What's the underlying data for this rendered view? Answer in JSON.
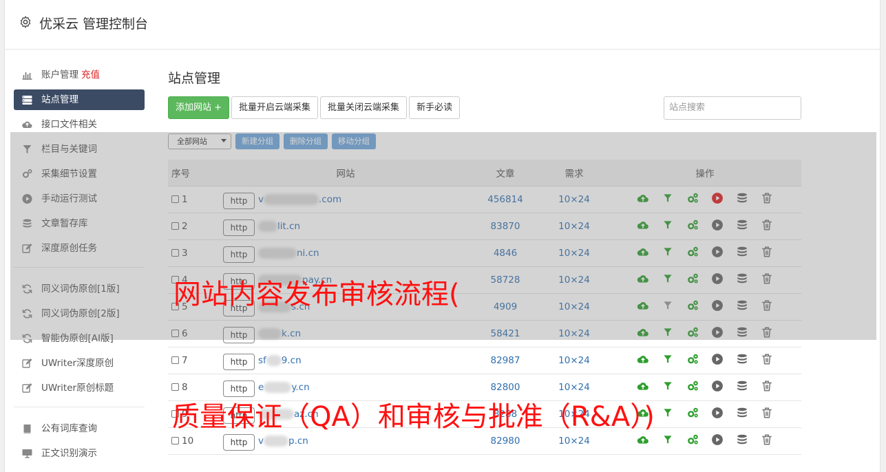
{
  "header": {
    "title": "优采云 管理控制台"
  },
  "sidebar": {
    "items": [
      {
        "label": "账户管理",
        "extra": "充值"
      },
      {
        "label": "站点管理"
      },
      {
        "label": "接口文件相关"
      },
      {
        "label": "栏目与关键词"
      },
      {
        "label": "采集细节设置"
      },
      {
        "label": "手动运行测试"
      },
      {
        "label": "文章暂存库"
      },
      {
        "label": "深度原创任务"
      },
      {
        "label": "同义词伪原创[1版]"
      },
      {
        "label": "同义词伪原创[2版]"
      },
      {
        "label": "智能伪原创[AI版]"
      },
      {
        "label": "UWriter深度原创"
      },
      {
        "label": "UWriter原创标题"
      },
      {
        "label": "公有词库查询"
      },
      {
        "label": "正文识别演示"
      }
    ]
  },
  "main": {
    "title": "站点管理",
    "buttons": {
      "add": "添加网站 +",
      "enable_cloud": "批量开启云端采集",
      "disable_cloud": "批量关闭云端采集",
      "guide": "新手必读"
    },
    "search_placeholder": "站点搜索",
    "group_select": "全部网站",
    "group_buttons": {
      "new": "新建分组",
      "delete": "删除分组",
      "move": "移动分组"
    },
    "columns": {
      "no": "序号",
      "site": "网站",
      "articles": "文章",
      "demand": "需求",
      "ops": "操作"
    },
    "http_label": "http",
    "rows": [
      {
        "no": "1",
        "prefix": "v",
        "suffix": ".com",
        "articles": "456814",
        "demand": "10×24",
        "running": true,
        "filter_on": true
      },
      {
        "no": "2",
        "prefix": "",
        "suffix": "lit.cn",
        "articles": "83870",
        "demand": "10×24",
        "running": false,
        "filter_on": true
      },
      {
        "no": "3",
        "prefix": "",
        "suffix": "ni.cn",
        "articles": "4846",
        "demand": "10×24",
        "running": false,
        "filter_on": true
      },
      {
        "no": "4",
        "prefix": "",
        "suffix": "pay.cn",
        "articles": "58728",
        "demand": "10×24",
        "running": false,
        "filter_on": true
      },
      {
        "no": "5",
        "prefix": "",
        "suffix": "s.cn",
        "articles": "4909",
        "demand": "10×24",
        "running": false,
        "filter_on": false
      },
      {
        "no": "6",
        "prefix": "",
        "suffix": "k.cn",
        "articles": "58421",
        "demand": "10×24",
        "running": false,
        "filter_on": true
      },
      {
        "no": "7",
        "prefix": "sf",
        "suffix": "9.cn",
        "articles": "82987",
        "demand": "10×24",
        "running": false,
        "filter_on": true
      },
      {
        "no": "8",
        "prefix": "e",
        "suffix": "y.cn",
        "articles": "82800",
        "demand": "10×24",
        "running": false,
        "filter_on": true
      },
      {
        "no": "9",
        "prefix": "",
        "suffix": "az.cn",
        "articles": "8288",
        "demand": "10×24",
        "running": false,
        "filter_on": true
      },
      {
        "no": "10",
        "prefix": "v",
        "suffix": "p.cn",
        "articles": "82980",
        "demand": "10×24",
        "running": false,
        "filter_on": true
      }
    ]
  },
  "captions": {
    "top": "网站内容发布审核流程(",
    "bottom": "质量保证（QA）和审核与批准（R&A）)"
  },
  "colors": {
    "accent_green": "#5cb85c",
    "nav_active": "#3c4b64",
    "link_blue": "#2f6fb0",
    "caption_red": "#ff1010",
    "icon_green": "#2e9e2e",
    "run_red": "#e02020"
  }
}
